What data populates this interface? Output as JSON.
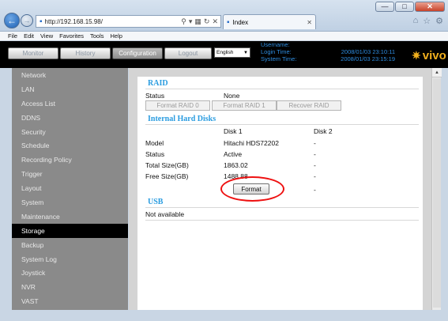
{
  "browser": {
    "url": "http://192.168.15.98/",
    "tab_title": "Index",
    "menu": [
      "File",
      "Edit",
      "View",
      "Favorites",
      "Tools",
      "Help"
    ]
  },
  "header": {
    "buttons": {
      "monitor": "Monitor",
      "history": "History",
      "configuration": "Configuration",
      "logout": "Logout"
    },
    "language": "English",
    "info": {
      "username_label": "Username:",
      "username_value": "",
      "login_time_label": "Login Time:",
      "login_time_value": "2008/01/03 23:10:11",
      "system_time_label": "System Time:",
      "system_time_value": "2008/01/03 23:15:19"
    },
    "logo_text": "vivo"
  },
  "sidebar": {
    "items": [
      {
        "label": "Network"
      },
      {
        "label": "LAN"
      },
      {
        "label": "Access List"
      },
      {
        "label": "DDNS"
      },
      {
        "label": "Security"
      },
      {
        "label": "Schedule"
      },
      {
        "label": "Recording Policy"
      },
      {
        "label": "Trigger"
      },
      {
        "label": "Layout"
      },
      {
        "label": "System"
      },
      {
        "label": "Maintenance"
      },
      {
        "label": "Storage"
      },
      {
        "label": "Backup"
      },
      {
        "label": "System Log"
      },
      {
        "label": "Joystick"
      },
      {
        "label": "NVR"
      },
      {
        "label": "VAST"
      }
    ],
    "active": "Storage"
  },
  "raid": {
    "title": "RAID",
    "status_label": "Status",
    "status_value": "None",
    "buttons": {
      "format_raid0": "Format RAID 0",
      "format_raid1": "Format RAID 1",
      "recover_raid": "Recover RAID"
    }
  },
  "disks": {
    "title": "Internal Hard Disks",
    "columns": [
      "Disk 1",
      "Disk 2"
    ],
    "rows": [
      {
        "label": "Model",
        "disk1": "Hitachi HDS72202",
        "disk2": "-"
      },
      {
        "label": "Status",
        "disk1": "Active",
        "disk2": "-"
      },
      {
        "label": "Total Size(GB)",
        "disk1": "1863.02",
        "disk2": "-"
      },
      {
        "label": "Free Size(GB)",
        "disk1": "1488.88",
        "disk2": "-"
      }
    ],
    "format_label": "Format",
    "format_disk2": "-"
  },
  "usb": {
    "title": "USB",
    "status": "Not available"
  },
  "colors": {
    "accent": "#2a9ce0",
    "highlight": "#e11111"
  }
}
